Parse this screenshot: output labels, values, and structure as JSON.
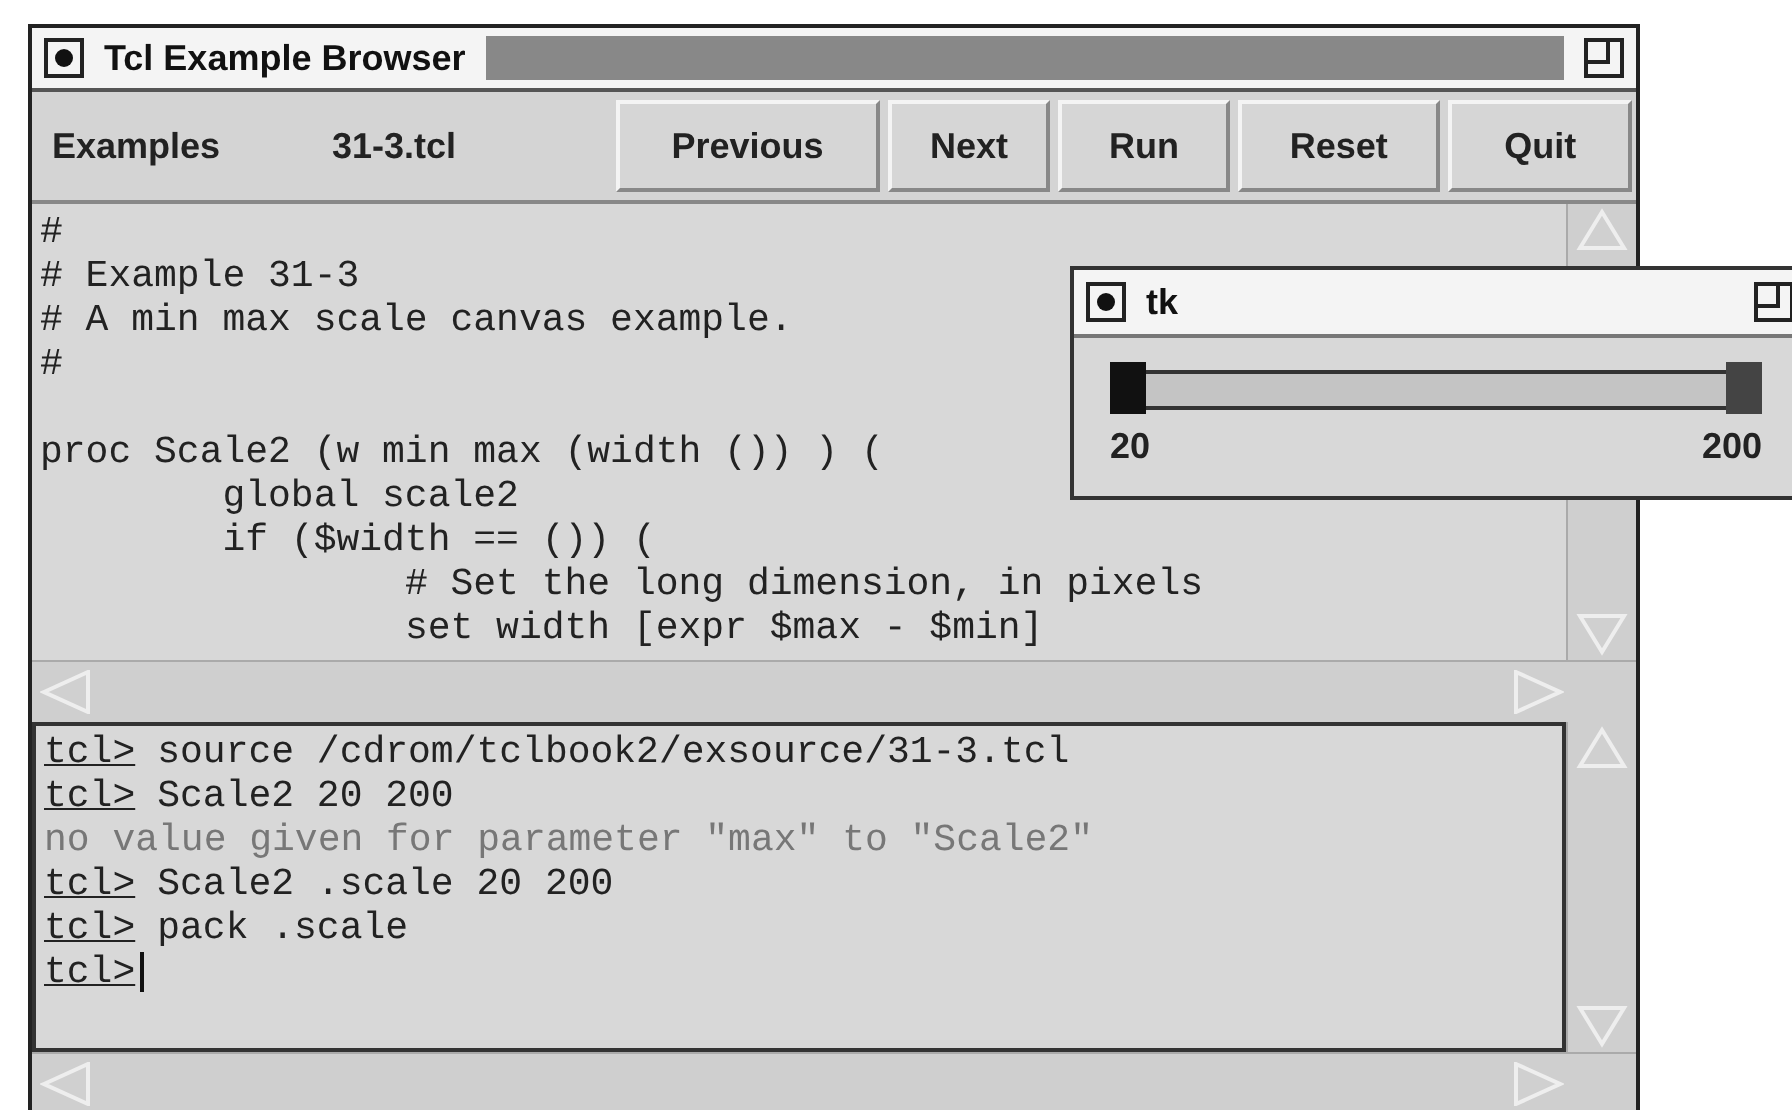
{
  "window": {
    "title": "Tcl Example Browser"
  },
  "toolbar": {
    "menu": "Examples",
    "file": "31-3.tcl",
    "buttons": [
      "Previous",
      "Next",
      "Run",
      "Reset",
      "Quit"
    ]
  },
  "code": "#\n# Example 31-3\n# A min max scale canvas example.\n#\n\nproc Scale2 (w min max (width ()) ) (\n\tglobal scale2\n\tif ($width == ()) (\n\t\t# Set the long dimension, in pixels\n\t\tset width [expr $max - $min]",
  "console": [
    {
      "kind": "command",
      "prompt": "tcl>",
      "text": "source /cdrom/tclbook2/exsource/31-3.tcl"
    },
    {
      "kind": "command",
      "prompt": "tcl>",
      "text": "Scale2 20 200"
    },
    {
      "kind": "error",
      "text": "no value given for parameter \"max\" to \"Scale2\""
    },
    {
      "kind": "command",
      "prompt": "tcl>",
      "text": "Scale2 .scale 20 200"
    },
    {
      "kind": "command",
      "prompt": "tcl>",
      "text": "pack .scale"
    },
    {
      "kind": "input",
      "prompt": "tcl>"
    }
  ],
  "tk_window": {
    "title": "tk",
    "markers": [
      {
        "level": 0,
        "label": "20",
        "selected": true
      },
      {
        "level": 1,
        "label": "200",
        "selected": false
      }
    ]
  }
}
